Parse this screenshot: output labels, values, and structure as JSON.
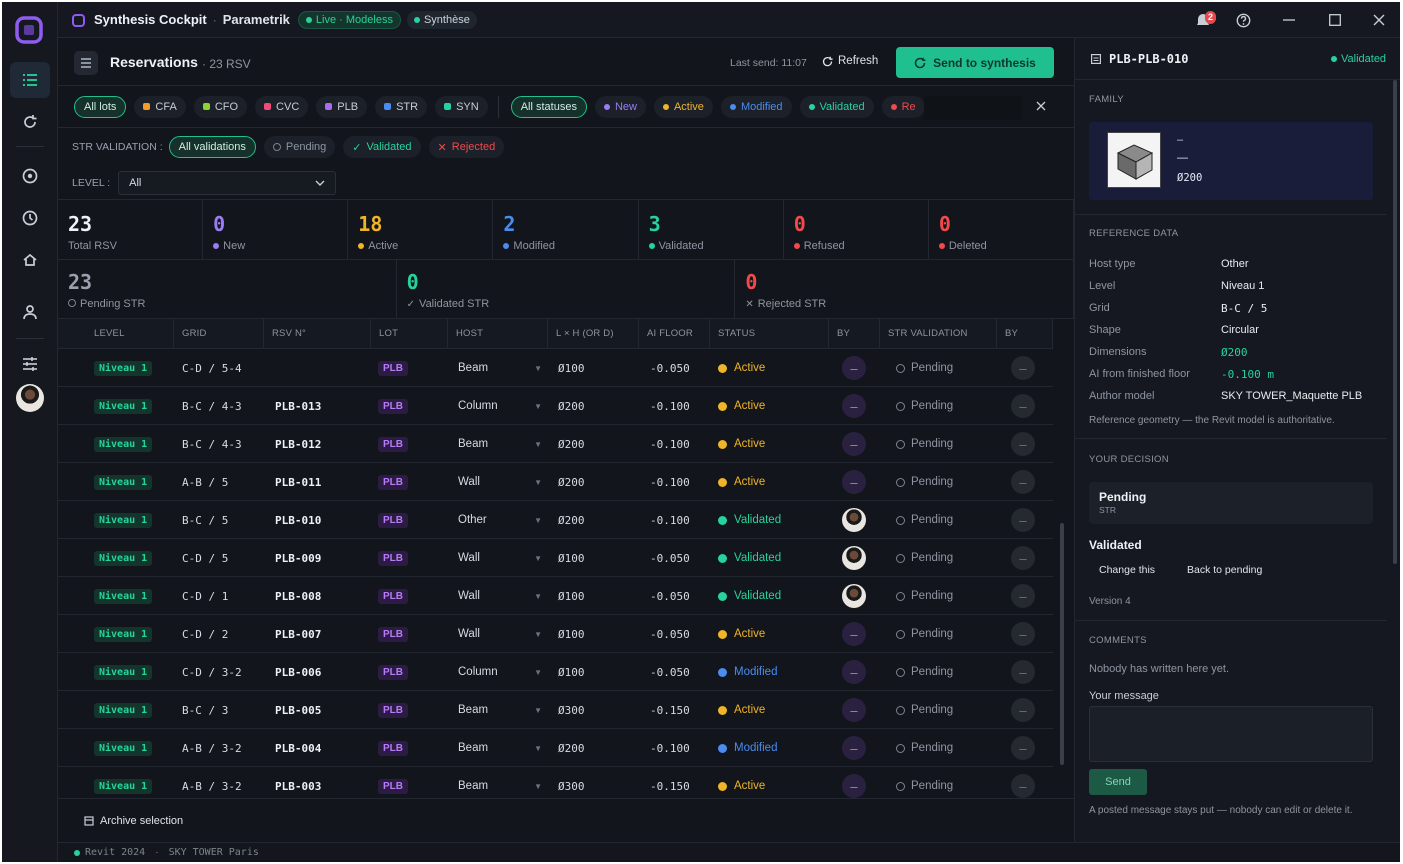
{
  "titlebar": {
    "title": "Synthesis Cockpit",
    "subtitle": "Parametrik",
    "live_badge": "Live · Modeless",
    "synth_badge": "Synthèse",
    "notif_count": "2"
  },
  "header": {
    "title": "Reservations",
    "count": "· 23 RSV",
    "last_send": "Last send: 11:07",
    "refresh": "Refresh",
    "send": "Send to synthesis"
  },
  "lot_filters": [
    {
      "label": "All lots",
      "color": "",
      "on": true
    },
    {
      "label": "CFA",
      "color": "#f39c2b"
    },
    {
      "label": "CFO",
      "color": "#8bd335"
    },
    {
      "label": "CVC",
      "color": "#f04a7a"
    },
    {
      "label": "PLB",
      "color": "#a86cf0"
    },
    {
      "label": "STR",
      "color": "#4a8cf0"
    },
    {
      "label": "SYN",
      "color": "#27d39c"
    }
  ],
  "status_filters": [
    {
      "label": "All statuses",
      "color": "",
      "on": true
    },
    {
      "label": "New",
      "color": "#9b7cf5"
    },
    {
      "label": "Active",
      "color": "#f0b429"
    },
    {
      "label": "Modified",
      "color": "#4a8cf0"
    },
    {
      "label": "Validated",
      "color": "#27d39c"
    },
    {
      "label": "Re",
      "color": "#f04a4a"
    }
  ],
  "str_validation": {
    "label": "STR VALIDATION :",
    "options": [
      "All validations",
      "Pending",
      "Validated",
      "Rejected"
    ]
  },
  "level_filter": {
    "label": "LEVEL :",
    "value": "All"
  },
  "stats_top": [
    {
      "n": "23",
      "label": "Total RSV",
      "color": "#eef1f6",
      "dot": ""
    },
    {
      "n": "0",
      "label": "New",
      "color": "#9b7cf5",
      "dot": "#9b7cf5"
    },
    {
      "n": "18",
      "label": "Active",
      "color": "#f0b429",
      "dot": "#f0b429"
    },
    {
      "n": "2",
      "label": "Modified",
      "color": "#4a8cf0",
      "dot": "#4a8cf0"
    },
    {
      "n": "3",
      "label": "Validated",
      "color": "#27d39c",
      "dot": "#27d39c"
    },
    {
      "n": "0",
      "label": "Refused",
      "color": "#f04a4a",
      "dot": "#f04a4a"
    },
    {
      "n": "0",
      "label": "Deleted",
      "color": "#f04a4a",
      "dot": "#f04a4a"
    }
  ],
  "stats_bottom": [
    {
      "n": "23",
      "label": "Pending STR",
      "color": "#9aa1ad",
      "icon": "ring"
    },
    {
      "n": "0",
      "label": "Validated STR",
      "color": "#27d39c",
      "icon": "check"
    },
    {
      "n": "0",
      "label": "Rejected STR",
      "color": "#f04a4a",
      "icon": "cross"
    }
  ],
  "columns": [
    "LEVEL",
    "GRID",
    "RSV N°",
    "LOT",
    "HOST",
    "L × H (or D)",
    "AI FLOOR",
    "STATUS",
    "BY",
    "STR VALIDATION",
    "BY"
  ],
  "rows": [
    {
      "level": "Niveau 1",
      "grid": "C-D / 5-4",
      "rsv": "",
      "lot": "PLB",
      "host": "Beam",
      "dim": "Ø100",
      "ai": "-0.050",
      "status": "Active",
      "by": "dash",
      "strv": "Pending"
    },
    {
      "level": "Niveau 1",
      "grid": "B-C / 4-3",
      "rsv": "PLB-013",
      "lot": "PLB",
      "host": "Column",
      "dim": "Ø200",
      "ai": "-0.100",
      "status": "Active",
      "by": "dash",
      "strv": "Pending"
    },
    {
      "level": "Niveau 1",
      "grid": "B-C / 4-3",
      "rsv": "PLB-012",
      "lot": "PLB",
      "host": "Beam",
      "dim": "Ø200",
      "ai": "-0.100",
      "status": "Active",
      "by": "dash",
      "strv": "Pending"
    },
    {
      "level": "Niveau 1",
      "grid": "A-B / 5",
      "rsv": "PLB-011",
      "lot": "PLB",
      "host": "Wall",
      "dim": "Ø200",
      "ai": "-0.100",
      "status": "Active",
      "by": "dash",
      "strv": "Pending"
    },
    {
      "level": "Niveau 1",
      "grid": "B-C / 5",
      "rsv": "PLB-010",
      "lot": "PLB",
      "host": "Other",
      "dim": "Ø200",
      "ai": "-0.100",
      "status": "Validated",
      "by": "avatar",
      "strv": "Pending"
    },
    {
      "level": "Niveau 1",
      "grid": "C-D / 5",
      "rsv": "PLB-009",
      "lot": "PLB",
      "host": "Wall",
      "dim": "Ø100",
      "ai": "-0.050",
      "status": "Validated",
      "by": "avatar",
      "strv": "Pending"
    },
    {
      "level": "Niveau 1",
      "grid": "C-D / 1",
      "rsv": "PLB-008",
      "lot": "PLB",
      "host": "Wall",
      "dim": "Ø100",
      "ai": "-0.050",
      "status": "Validated",
      "by": "avatar",
      "strv": "Pending"
    },
    {
      "level": "Niveau 1",
      "grid": "C-D / 2",
      "rsv": "PLB-007",
      "lot": "PLB",
      "host": "Wall",
      "dim": "Ø100",
      "ai": "-0.050",
      "status": "Active",
      "by": "dash",
      "strv": "Pending"
    },
    {
      "level": "Niveau 1",
      "grid": "C-D / 3-2",
      "rsv": "PLB-006",
      "lot": "PLB",
      "host": "Column",
      "dim": "Ø100",
      "ai": "-0.050",
      "status": "Modified",
      "by": "dash",
      "strv": "Pending"
    },
    {
      "level": "Niveau 1",
      "grid": "B-C / 3",
      "rsv": "PLB-005",
      "lot": "PLB",
      "host": "Beam",
      "dim": "Ø300",
      "ai": "-0.150",
      "status": "Active",
      "by": "dash",
      "strv": "Pending"
    },
    {
      "level": "Niveau 1",
      "grid": "A-B / 3-2",
      "rsv": "PLB-004",
      "lot": "PLB",
      "host": "Beam",
      "dim": "Ø200",
      "ai": "-0.100",
      "status": "Modified",
      "by": "dash",
      "strv": "Pending"
    },
    {
      "level": "Niveau 1",
      "grid": "A-B / 3-2",
      "rsv": "PLB-003",
      "lot": "PLB",
      "host": "Beam",
      "dim": "Ø300",
      "ai": "-0.150",
      "status": "Active",
      "by": "dash",
      "strv": "Pending"
    }
  ],
  "status_colors": {
    "Active": "#f0b429",
    "Validated": "#27d39c",
    "Modified": "#4a8cf0"
  },
  "footer": {
    "archive": "Archive selection"
  },
  "panel": {
    "title": "PLB-PLB-010",
    "badge": "Validated",
    "family_label": "FAMILY",
    "family_line1": "–",
    "family_line2": "—",
    "family_dim": "Ø200",
    "ref_label": "REFERENCE DATA",
    "ref": [
      {
        "k": "Host type",
        "v": "Other",
        "mono": false,
        "green": false
      },
      {
        "k": "Level",
        "v": "Niveau 1",
        "mono": false,
        "green": false
      },
      {
        "k": "Grid",
        "v": "B-C / 5",
        "mono": true,
        "green": false
      },
      {
        "k": "Shape",
        "v": "Circular",
        "mono": false,
        "green": false
      },
      {
        "k": "Dimensions",
        "v": "Ø200",
        "mono": true,
        "green": true
      },
      {
        "k": "AI from finished floor",
        "v": "-0.100 m",
        "mono": true,
        "green": true
      },
      {
        "k": "Author model",
        "v": "SKY TOWER_Maquette PLB",
        "mono": false,
        "green": false
      }
    ],
    "ref_note": "Reference geometry — the Revit model is authoritative.",
    "decision_label": "YOUR DECISION",
    "decision_status": "Pending",
    "decision_sub": "STR",
    "validated_title": "Validated",
    "change_this": "Change this",
    "back_pending": "Back to pending",
    "version": "Version 4",
    "comments_label": "COMMENTS",
    "no_comments": "Nobody has written here yet.",
    "your_message": "Your message",
    "send": "Send",
    "post_note": "A posted message stays put — nobody can edit or delete it."
  },
  "statusbar": {
    "revit": "Revit 2024",
    "project": "SKY TOWER Paris"
  }
}
